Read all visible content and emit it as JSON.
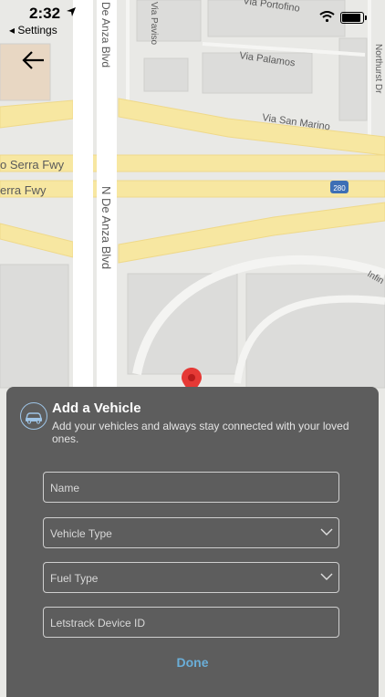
{
  "status_bar": {
    "time": "2:32",
    "back_app": "◂ Settings"
  },
  "map": {
    "streets": {
      "de_anza_blvd_top": "De Anza Blvd",
      "via_paviso": "Via Paviso",
      "via_portofino": "Via Portofino",
      "via_palamos": "Via Palamos",
      "via_san_marino": "Via San Marino",
      "northurst": "Northurst Dr",
      "serra_fwy_1": "o Serra Fwy",
      "serra_fwy_2": "erra Fwy",
      "n_de_anza_blvd": "N De Anza Blvd",
      "infinite": "Infin"
    },
    "highway_shield": "280"
  },
  "sheet": {
    "title": "Add a Vehicle",
    "subtitle": "Add your vehicles and always stay connected with  your loved ones.",
    "fields": [
      {
        "label": "Name"
      },
      {
        "label": "Vehicle Type"
      },
      {
        "label": "Fuel Type"
      },
      {
        "label": "Letstrack Device ID"
      }
    ],
    "done_label": "Done"
  },
  "colors": {
    "sheet_bg": "#5d5d5d",
    "accent": "#6aaed8",
    "highway": "#f7e7a1",
    "pin": "#e53935"
  },
  "icons": [
    "location-arrow-icon",
    "wifi-icon",
    "battery-icon",
    "back-arrow-icon",
    "map-pin-icon",
    "car-icon",
    "chevron-down-icon"
  ]
}
